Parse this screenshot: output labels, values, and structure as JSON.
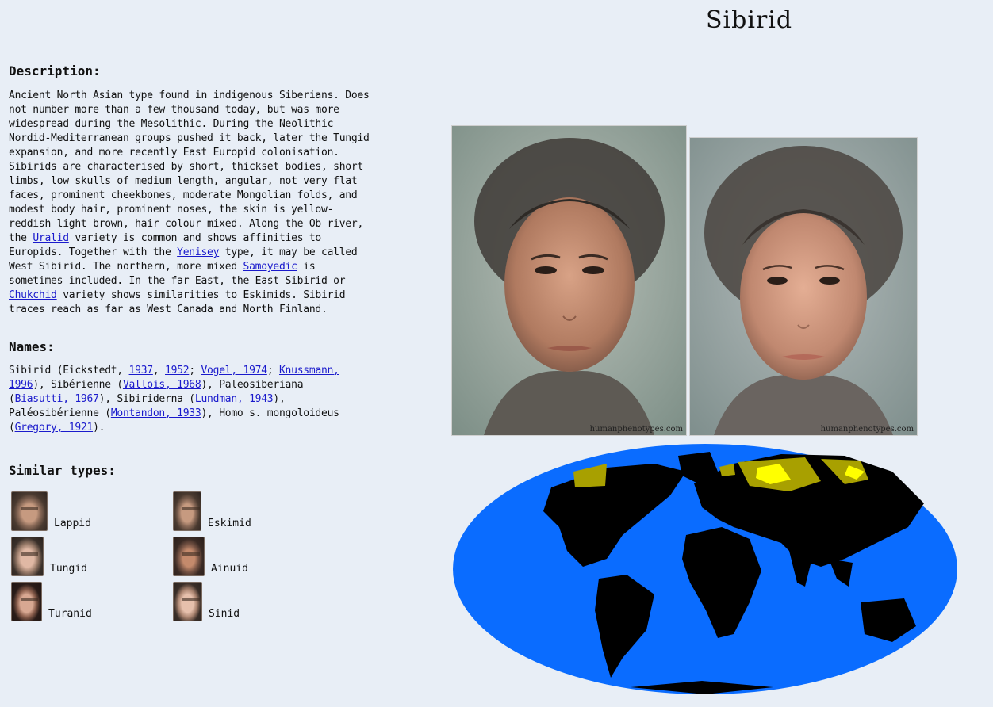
{
  "page": {
    "title": "Sibirid"
  },
  "description": {
    "heading": "Description:",
    "parts": [
      "Ancient North Asian type found in indigenous Siberians. Does not number more than a few thousand today, but was more widespread during the Mesolithic. During the Neolithic Nordid-Mediterranean groups pushed it back, later the Tungid expansion, and more recently East Europid colonisation. Sibirids are characterised by short, thickset bodies, short limbs, low skulls of medium length, angular, not very flat faces, prominent cheekbones, moderate Mongolian folds, and modest body hair, prominent noses, the skin is yellow-reddish light brown, hair colour mixed. Along the Ob river, the ",
      "Uralid",
      " variety is common and shows affinities to Europids. Together with the ",
      "Yenisey",
      " type, it may be called West Sibirid. The northern, more mixed ",
      "Samoyedic",
      " is sometimes included. In the far East, the East Sibirid or ",
      "Chukchid",
      " variety shows similarities to Eskimids. Sibirid traces reach as far as West Canada and North Finland."
    ]
  },
  "names": {
    "heading": "Names:",
    "t1": "Sibirid (Eickstedt, ",
    "l1": "1937",
    "t2": ", ",
    "l2": "1952",
    "t3": "; ",
    "l3": "Vogel, 1974",
    "t4": "; ",
    "l4": "Knussmann, 1996",
    "t5": "), Sibérienne (",
    "l5": "Vallois, 1968",
    "t6": "), Paleosiberiana (",
    "l6": "Biasutti, 1967",
    "t7": "), Sibiriderna (",
    "l7": "Lundman, 1943",
    "t8": "), Paléosibérienne (",
    "l8": "Montandon, 1933",
    "t9": "), Homo s. mongoloideus (",
    "l9": "Gregory, 1921",
    "t10": ")."
  },
  "similar": {
    "heading": "Similar types:",
    "items": [
      "Lappid",
      "Eskimid",
      "Tungid",
      "Ainuid",
      "Turanid",
      "Sinid"
    ]
  },
  "photos": {
    "male_watermark": "humanphenotypes.com",
    "female_watermark": "humanphenotypes.com"
  },
  "map": {
    "ocean_color": "#0a6cff",
    "land_color": "#000000",
    "core_color": "#ffff00",
    "trace_color": "#a8a000"
  }
}
